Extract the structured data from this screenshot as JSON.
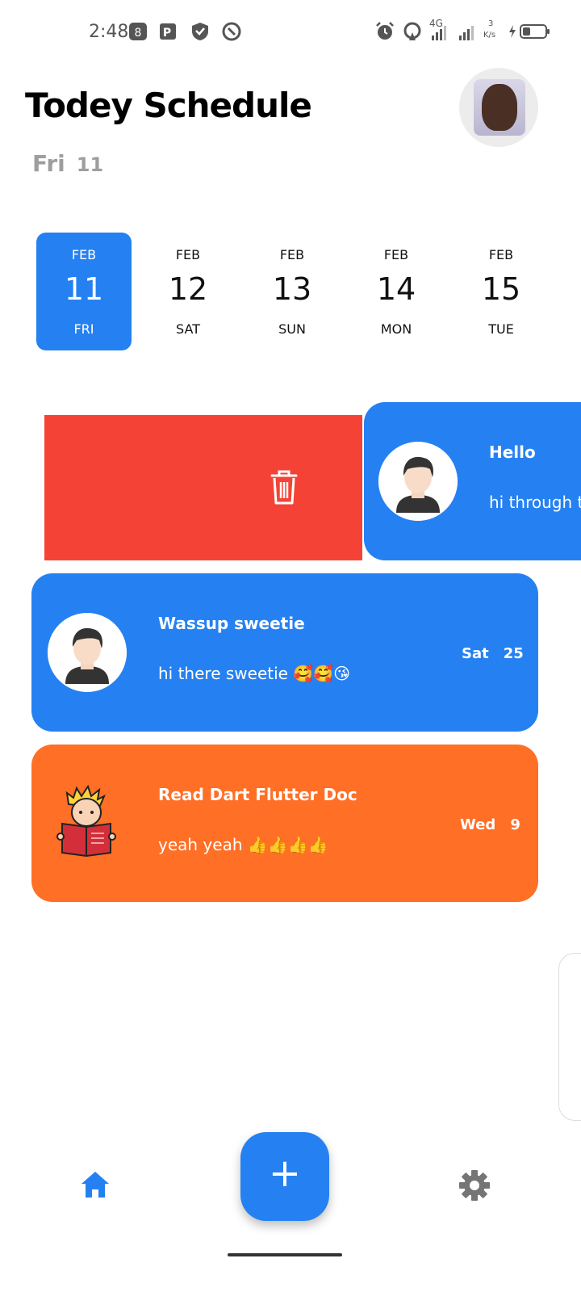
{
  "status_bar": {
    "time": "2:48",
    "network": "4G",
    "speed_value": "3",
    "speed_unit": "K/s"
  },
  "header": {
    "title": "Todey Schedule",
    "day": "Fri",
    "date": "11"
  },
  "date_picker": [
    {
      "month": "FEB",
      "day": "11",
      "weekday": "FRI",
      "selected": true
    },
    {
      "month": "FEB",
      "day": "12",
      "weekday": "SAT",
      "selected": false
    },
    {
      "month": "FEB",
      "day": "13",
      "weekday": "SUN",
      "selected": false
    },
    {
      "month": "FEB",
      "day": "14",
      "weekday": "MON",
      "selected": false
    },
    {
      "month": "FEB",
      "day": "15",
      "weekday": "TUE",
      "selected": false
    }
  ],
  "tasks": [
    {
      "title": "Hello",
      "note": "hi through t",
      "swiped": true,
      "color": "#2581f1"
    },
    {
      "title": "Wassup sweetie",
      "note": "hi there sweetie",
      "emoji": "🥰🥰😘",
      "day": "Sat",
      "date": "25",
      "color": "#2581f1"
    },
    {
      "title": "Read Dart Flutter Doc",
      "note": "yeah yeah",
      "emoji": "👍👍👍👍",
      "day": "Wed",
      "date": "9",
      "color": "#ff6f26"
    }
  ],
  "colors": {
    "accent": "#2581f1",
    "delete": "#f44336",
    "orange": "#ff6f26",
    "muted": "#9e9e9e"
  },
  "nav": {
    "add_label": "+",
    "home_icon": "home-icon",
    "settings_icon": "gear-icon"
  }
}
